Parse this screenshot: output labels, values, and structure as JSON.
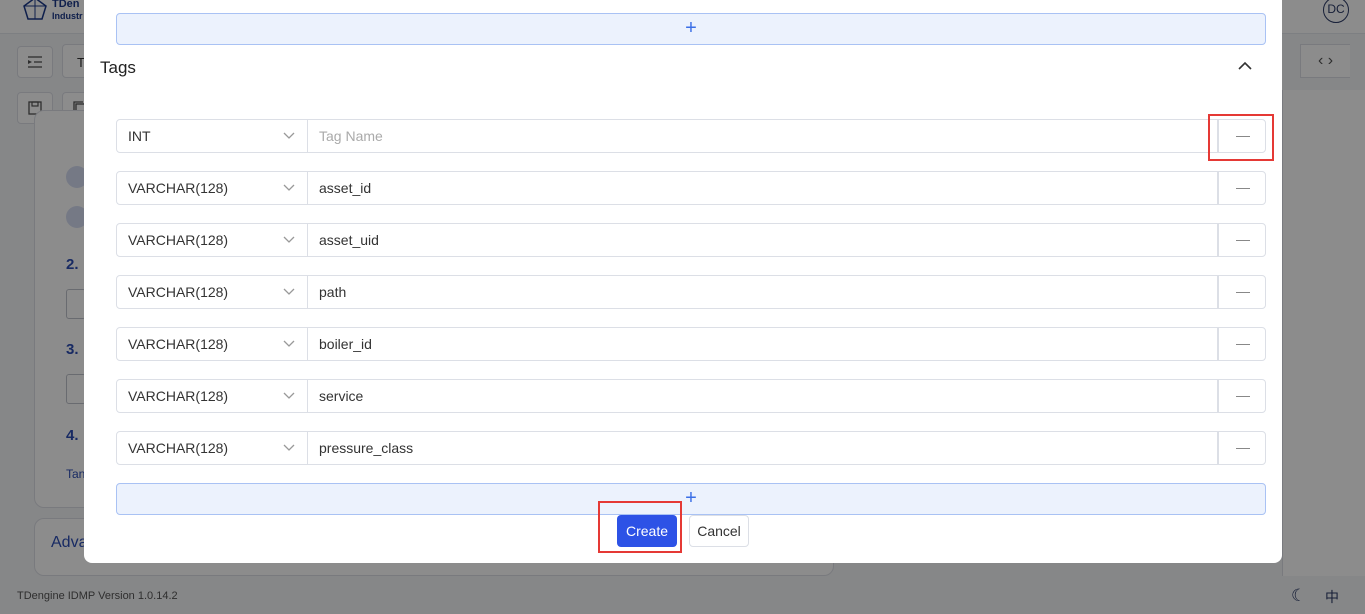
{
  "app": {
    "logo_text": "TDen",
    "logo_sub": "Industr",
    "user_initials": "DC",
    "tab_partial": "T",
    "nav_arrows": "‹ ›",
    "steps": [
      "2.",
      "3.",
      "4."
    ],
    "step_link_partial": "Tan",
    "advanced_partial": "Adva",
    "footer_version": "TDengine IDMP Version 1.0.14.2",
    "lang": "中"
  },
  "modal": {
    "section_title": "Tags",
    "add_symbol": "+",
    "tags": [
      {
        "type": "INT",
        "name": "",
        "placeholder": "Tag Name"
      },
      {
        "type": "VARCHAR(128)",
        "name": "asset_id",
        "placeholder": "Tag Name"
      },
      {
        "type": "VARCHAR(128)",
        "name": "asset_uid",
        "placeholder": "Tag Name"
      },
      {
        "type": "VARCHAR(128)",
        "name": "path",
        "placeholder": "Tag Name"
      },
      {
        "type": "VARCHAR(128)",
        "name": "boiler_id",
        "placeholder": "Tag Name"
      },
      {
        "type": "VARCHAR(128)",
        "name": "service",
        "placeholder": "Tag Name"
      },
      {
        "type": "VARCHAR(128)",
        "name": "pressure_class",
        "placeholder": "Tag Name"
      }
    ],
    "create_label": "Create",
    "cancel_label": "Cancel"
  },
  "colors": {
    "primary": "#2d52e6",
    "add_bar_bg": "#ecf2fd",
    "highlight": "#e53935"
  }
}
